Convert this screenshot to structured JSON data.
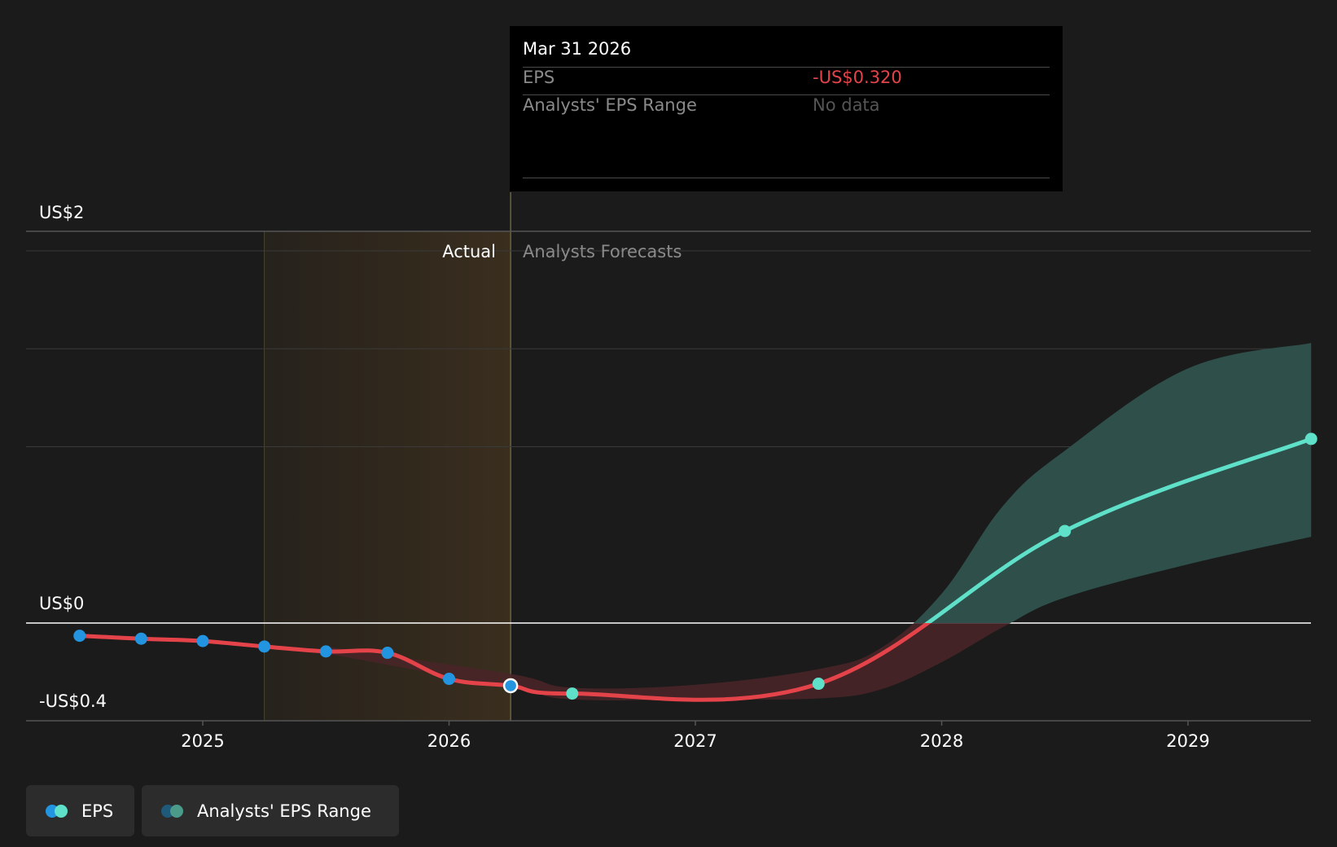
{
  "colors": {
    "background": "#1b1b1b",
    "eps_actual": "#2394df",
    "eps_forecast": "#5fe0c9",
    "eps_negative_line": "#e5434a",
    "range_positive": "#2e4f4a",
    "range_negative": "#4a2428",
    "actual_shade": "#3a2e1e",
    "zero_line": "#ffffff",
    "grid": "#3a3a3a"
  },
  "tooltip": {
    "date": "Mar 31 2026",
    "eps_key": "EPS",
    "eps_value": "-US$0.320",
    "range_key": "Analysts' EPS Range",
    "range_value": "No data"
  },
  "legend": [
    {
      "label": "EPS",
      "icon": "eps-legend-icon",
      "colors": [
        "#2394df",
        "#5fe0c9"
      ]
    },
    {
      "label": "Analysts' EPS Range",
      "icon": "range-legend-icon",
      "colors": [
        "#1f5a7a",
        "#4c9a8a"
      ]
    }
  ],
  "chart_data": {
    "type": "line",
    "title": "",
    "xlabel": "",
    "ylabel": "",
    "section_labels": {
      "actual": "Actual",
      "forecast": "Analysts Forecasts"
    },
    "y_tick_labels": [
      {
        "value": 2,
        "label": "US$2"
      },
      {
        "value": 0,
        "label": "US$0"
      },
      {
        "value": -0.4,
        "label": "-US$0.4"
      }
    ],
    "x_tick_labels": [
      {
        "value": 2025.0,
        "label": "2025"
      },
      {
        "value": 2026.0,
        "label": "2026"
      },
      {
        "value": 2027.0,
        "label": "2027"
      },
      {
        "value": 2028.0,
        "label": "2028"
      },
      {
        "value": 2029.0,
        "label": "2029"
      }
    ],
    "xlim": [
      2024.3,
      2029.5
    ],
    "ylim": [
      -0.4,
      2.0
    ],
    "gridlines_y": [
      1.9,
      1.4,
      0.9
    ],
    "actual_region": [
      2025.25,
      2026.25
    ],
    "selected_x": 2026.25,
    "series": [
      {
        "name": "EPS",
        "kind": "actual",
        "points": [
          [
            2024.5,
            -0.065
          ],
          [
            2024.75,
            -0.08
          ],
          [
            2025.0,
            -0.092
          ],
          [
            2025.25,
            -0.12
          ],
          [
            2025.5,
            -0.145
          ],
          [
            2025.75,
            -0.152
          ],
          [
            2026.0,
            -0.285
          ],
          [
            2026.25,
            -0.32
          ]
        ]
      },
      {
        "name": "EPS",
        "kind": "forecast",
        "points": [
          [
            2026.5,
            -0.36
          ],
          [
            2027.5,
            -0.31
          ],
          [
            2028.5,
            0.47
          ],
          [
            2029.5,
            0.94
          ]
        ]
      }
    ],
    "range_band": {
      "name": "Analysts' EPS Range",
      "x": [
        2025.5,
        2026.25,
        2026.5,
        2027.0,
        2027.5,
        2027.75,
        2028.0,
        2028.25,
        2028.5,
        2029.0,
        2029.5
      ],
      "upper": [
        -0.12,
        -0.26,
        -0.33,
        -0.315,
        -0.235,
        -0.13,
        0.15,
        0.6,
        0.88,
        1.3,
        1.43
      ],
      "lower": [
        -0.155,
        -0.33,
        -0.39,
        -0.39,
        -0.385,
        -0.34,
        -0.2,
        -0.02,
        0.13,
        0.3,
        0.44
      ]
    }
  }
}
